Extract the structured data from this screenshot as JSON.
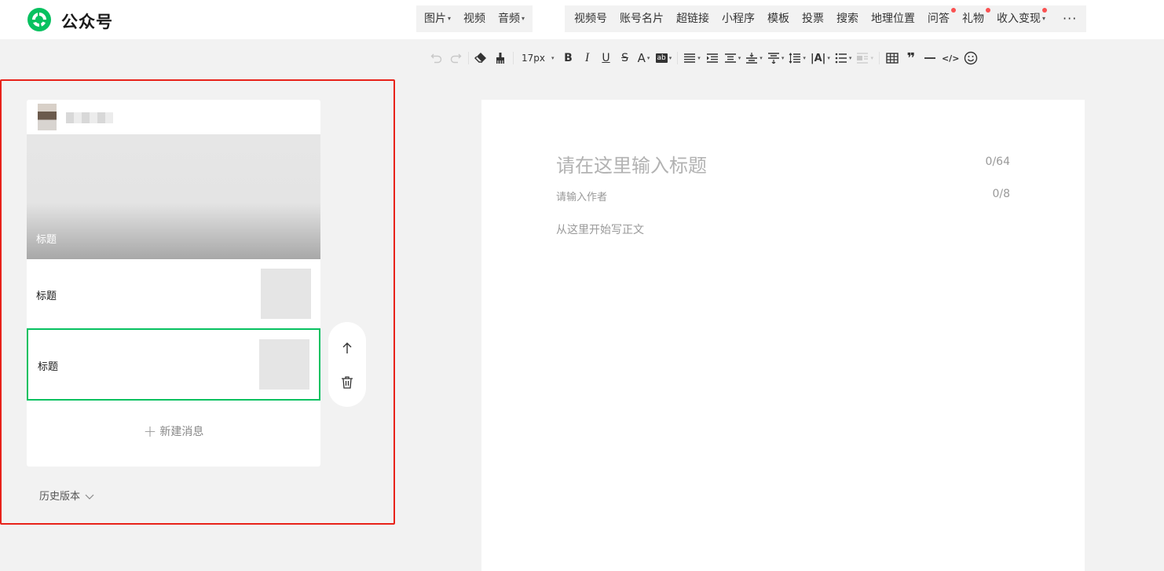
{
  "header": {
    "brand": "公众号",
    "brand_color": "#07c160",
    "menu_group1": [
      {
        "label": "图片",
        "has_caret": true
      },
      {
        "label": "视频",
        "has_caret": false
      },
      {
        "label": "音频",
        "has_caret": true
      }
    ],
    "menu_group2": [
      {
        "label": "视频号",
        "has_dot": false,
        "has_caret": false
      },
      {
        "label": "账号名片",
        "has_dot": false,
        "has_caret": false
      },
      {
        "label": "超链接",
        "has_dot": false,
        "has_caret": false
      },
      {
        "label": "小程序",
        "has_dot": false,
        "has_caret": false
      },
      {
        "label": "模板",
        "has_dot": false,
        "has_caret": false
      },
      {
        "label": "投票",
        "has_dot": false,
        "has_caret": false
      },
      {
        "label": "搜索",
        "has_dot": false,
        "has_caret": false
      },
      {
        "label": "地理位置",
        "has_dot": false,
        "has_caret": false
      },
      {
        "label": "问答",
        "has_dot": true,
        "has_caret": false
      },
      {
        "label": "礼物",
        "has_dot": true,
        "has_caret": false
      },
      {
        "label": "收入变现",
        "has_dot": true,
        "has_caret": true
      }
    ],
    "more_label": "···"
  },
  "toolbar": {
    "font_size": "17px",
    "bold": "B",
    "italic": "I",
    "underline": "U",
    "strike": "S",
    "font_color": "A",
    "bg_color": "ab",
    "letter_spacing": "|A|",
    "quote": "❞",
    "code": "</>"
  },
  "sidebar": {
    "cover_title": "标题",
    "articles": [
      {
        "title": "标题",
        "selected": false
      },
      {
        "title": "标题",
        "selected": true
      }
    ],
    "new_message": "新建消息",
    "history": "历史版本"
  },
  "editor": {
    "title_placeholder": "请在这里输入标题",
    "title_count": "0/64",
    "author_placeholder": "请输入作者",
    "author_count": "0/8",
    "body_placeholder": "从这里开始写正文"
  },
  "colors": {
    "selected_border": "#07c160",
    "highlight_outline": "#e8221a",
    "notify_dot": "#fa5151"
  }
}
